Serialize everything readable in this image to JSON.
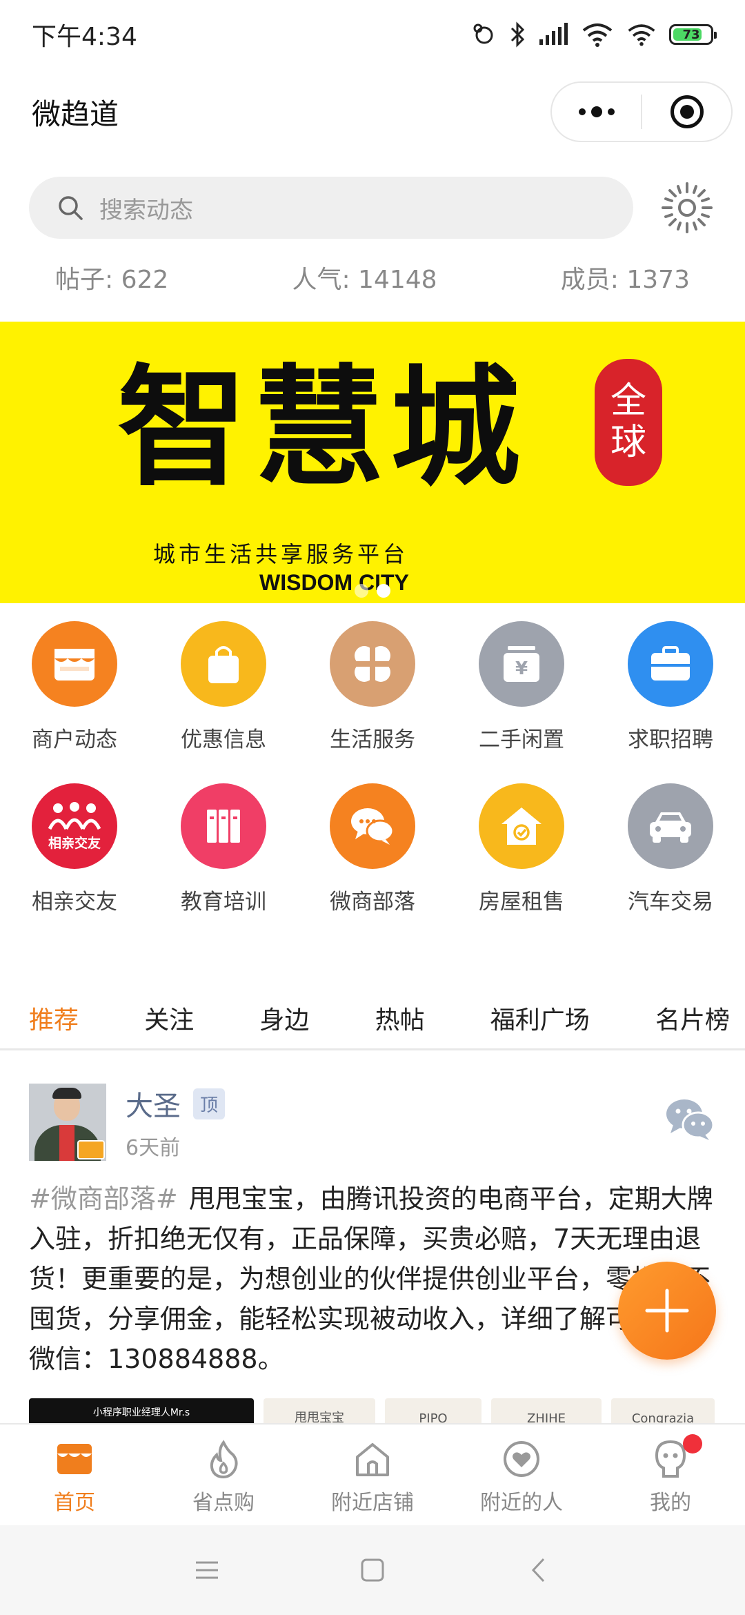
{
  "status_bar": {
    "time": "下午4:34",
    "battery": "73"
  },
  "header": {
    "title": "微趋道"
  },
  "search": {
    "placeholder": "搜索动态"
  },
  "stats": {
    "posts": "帖子: 622",
    "popularity": "人气: 14148",
    "members": "成员: 1373"
  },
  "banner": {
    "title": "智慧城",
    "seal_line1": "全",
    "seal_line2": "球",
    "subtitle": "城市生活共享服务平台",
    "english": "WISDOM CITY",
    "slides": 2,
    "active_slide": 2
  },
  "categories": [
    {
      "label": "商户动态",
      "icon": "storefront-icon",
      "color": "#f58220"
    },
    {
      "label": "优惠信息",
      "icon": "shopping-bag-icon",
      "color": "#f8b81c"
    },
    {
      "label": "生活服务",
      "icon": "clover-icon",
      "color": "#d8a072"
    },
    {
      "label": "二手闲置",
      "icon": "yen-box-icon",
      "color": "#9ea3ad"
    },
    {
      "label": "求职招聘",
      "icon": "briefcase-icon",
      "color": "#2f8ff0"
    },
    {
      "label": "相亲交友",
      "icon": "dating-icon",
      "color": "#e3213c",
      "icon_text": "相亲交友"
    },
    {
      "label": "教育培训",
      "icon": "books-icon",
      "color": "#f03e66"
    },
    {
      "label": "微商部落",
      "icon": "chat-bubbles-icon",
      "color": "#f58220"
    },
    {
      "label": "房屋租售",
      "icon": "house-check-icon",
      "color": "#f8b81c"
    },
    {
      "label": "汽车交易",
      "icon": "car-icon",
      "color": "#9ea3ad"
    }
  ],
  "tabs": [
    {
      "label": "推荐",
      "active": true
    },
    {
      "label": "关注",
      "active": false
    },
    {
      "label": "身边",
      "active": false
    },
    {
      "label": "热帖",
      "active": false
    },
    {
      "label": "福利广场",
      "active": false
    },
    {
      "label": "名片榜",
      "active": false
    }
  ],
  "post": {
    "author": "大圣",
    "pinned_label": "顶",
    "time": "6天前",
    "tag": "#微商部落#",
    "text": "甩甩宝宝，由腾讯投资的电商平台，定期大牌入驻，折扣绝无仅有，正品保障，买贵必赔，7天无理由退货！更重要的是，为想创业的伙伴提供创业平台，零投资不囤货，分享佣金，能轻松实现被动收入，详细了解可以加我微信：130884888。",
    "thumbnails": [
      "小程序职业经理人Mr.s",
      "甩甩宝宝",
      "PIPO",
      "ZHIHE",
      "Congrazia"
    ]
  },
  "bottom_nav": [
    {
      "label": "首页",
      "icon": "store-home-icon",
      "active": true
    },
    {
      "label": "省点购",
      "icon": "flame-icon",
      "active": false
    },
    {
      "label": "附近店铺",
      "icon": "house-icon",
      "active": false
    },
    {
      "label": "附近的人",
      "icon": "heart-circle-icon",
      "active": false
    },
    {
      "label": "我的",
      "icon": "profile-icon",
      "active": false,
      "badge": true
    }
  ],
  "colors": {
    "accent": "#f07e1d",
    "banner_bg": "#fff200",
    "badge_red": "#f0303a"
  }
}
